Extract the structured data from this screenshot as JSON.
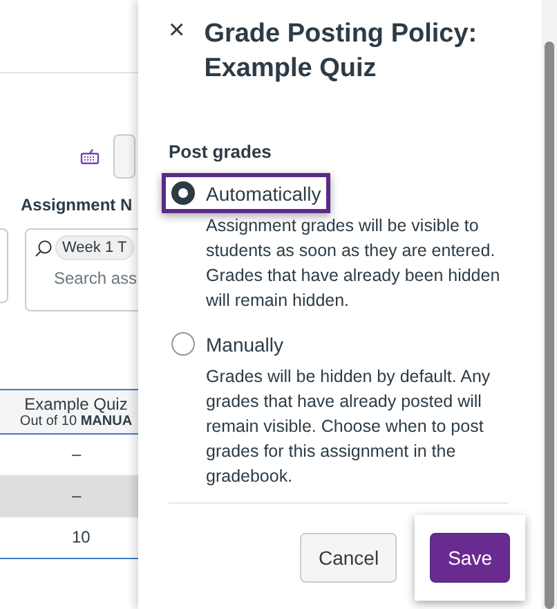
{
  "background": {
    "section_label": "Assignment N",
    "search": {
      "chip": "Week 1 T",
      "placeholder": "Search ass"
    },
    "column": {
      "title": "Example Quiz",
      "subtitle": "Out of 10 **MANUA**"
    },
    "rows": [
      {
        "value": "–",
        "shaded": false
      },
      {
        "value": "–",
        "shaded": true
      },
      {
        "value": "10",
        "shaded": false
      }
    ]
  },
  "panel": {
    "close": "×",
    "title": "Grade Posting Policy: Example Quiz",
    "group_label": "Post grades",
    "options": [
      {
        "label": "Automatically",
        "description": "Assignment grades will be visible to students as soon as they are entered. Grades that have already been hidden will remain hidden.",
        "selected": true,
        "highlighted": true
      },
      {
        "label": "Manually",
        "description": "Grades will be hidden by default. Any grades that have already posted will remain visible. Choose when to post grades for this assignment in the gradebook.",
        "selected": false,
        "highlighted": false
      }
    ],
    "buttons": [
      {
        "label": "Cancel",
        "kind": "secondary",
        "highlighted": false
      },
      {
        "label": "Save",
        "kind": "primary",
        "highlighted": true
      }
    ]
  }
}
